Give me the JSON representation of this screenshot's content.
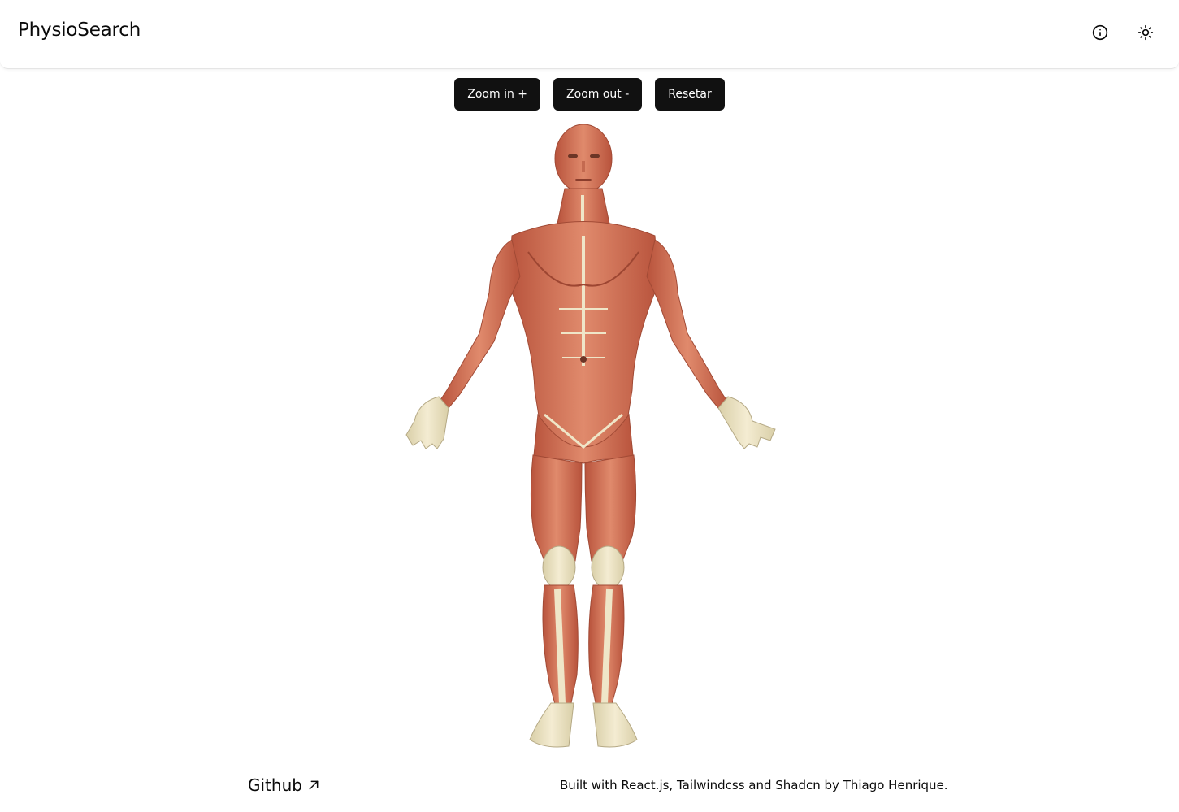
{
  "header": {
    "brand": "PhysioSearch",
    "info_icon": "info-icon",
    "theme_icon": "sun-icon"
  },
  "toolbar": {
    "zoom_in_label": "Zoom in +",
    "zoom_out_label": "Zoom out -",
    "reset_label": "Resetar"
  },
  "main": {
    "figure_icon": "human-muscle-anatomy-figure"
  },
  "footer": {
    "github_label": "Github",
    "github_icon": "arrow-up-right-icon",
    "credits": "Built with React.js, Tailwindcss and Shadcn by Thiago Henrique."
  },
  "colors": {
    "button_bg": "#111111",
    "button_text": "#ffffff",
    "muscle": "#d9775a",
    "tendon": "#efe6c8"
  }
}
